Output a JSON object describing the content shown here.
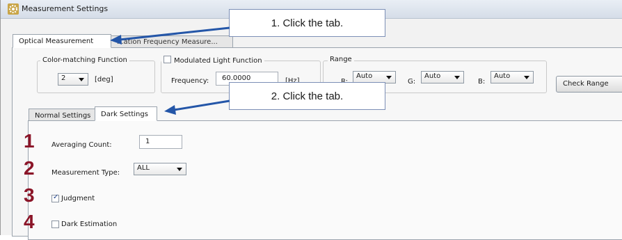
{
  "window": {
    "title": "Measurement Settings",
    "icon": "gear-icon"
  },
  "top_tabs": [
    {
      "label": "Optical Measurement",
      "active": true
    },
    {
      "label": "...ation Frequency Measure...",
      "active": false
    }
  ],
  "color_matching": {
    "group_label": "Color-matching Function",
    "selected": "2",
    "unit": "[deg]"
  },
  "modulated": {
    "checkbox_label": "Modulated Light Function",
    "checked": false,
    "frequency_label": "Frequency:",
    "frequency_value": "60.0000",
    "frequency_unit": "[Hz]"
  },
  "range": {
    "group_label": "Range",
    "r_label": "R:",
    "r_value": "Auto",
    "g_label": "G:",
    "g_value": "Auto",
    "b_label": "B:",
    "b_value": "Auto"
  },
  "check_range_button": "Check Range",
  "sub_tabs": [
    {
      "label": "Normal Settings",
      "active": false
    },
    {
      "label": "Dark Settings",
      "active": true
    }
  ],
  "dark_settings": {
    "averaging_label": "Averaging Count:",
    "averaging_value": "1",
    "measurement_type_label": "Measurement Type:",
    "measurement_type_value": "ALL",
    "judgment_label": "Judgment",
    "judgment_checked": true,
    "dark_estimation_label": "Dark Estimation",
    "dark_estimation_checked": false
  },
  "callouts": [
    "1. Click the tab.",
    "2. Click the tab."
  ],
  "steps": [
    "1",
    "2",
    "3",
    "4"
  ],
  "colors": {
    "step_number": "#8b1528",
    "arrow": "#2456a8",
    "callout_border": "#7c8fb6"
  }
}
